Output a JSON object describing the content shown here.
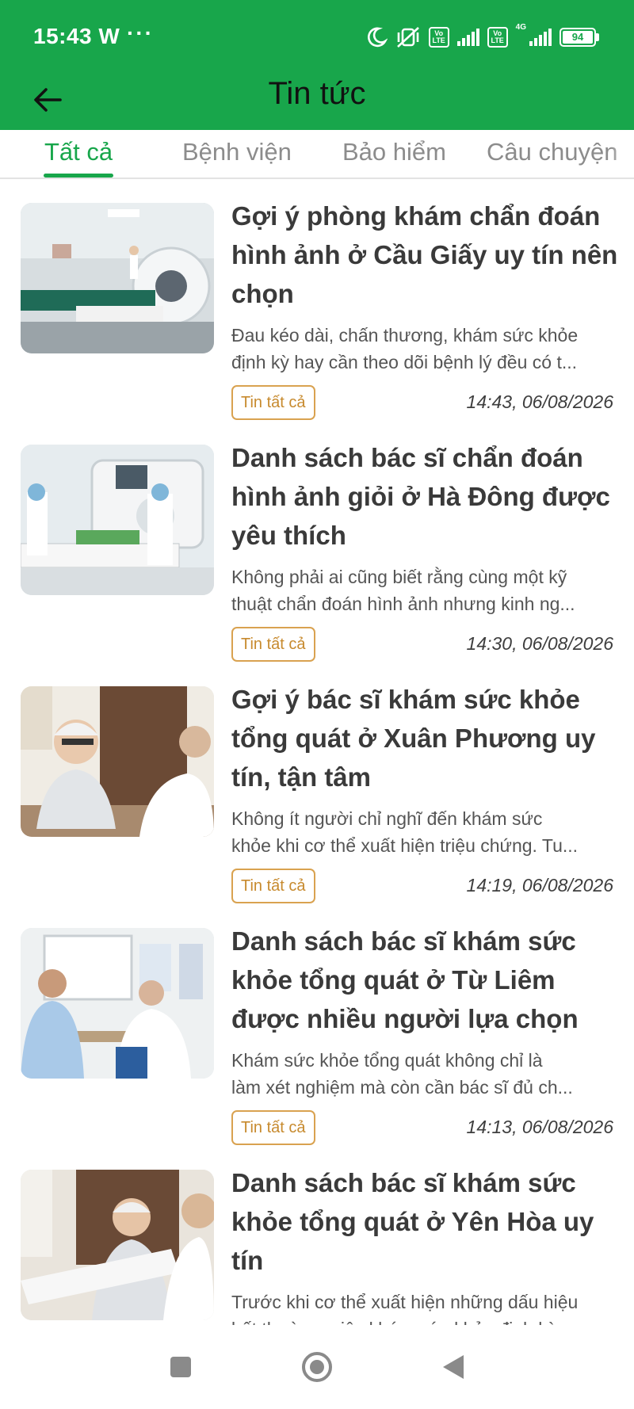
{
  "status_bar": {
    "time": "15:43",
    "time_suffix": "W",
    "more": "···",
    "network": "4G",
    "volte": "Vo LTE",
    "battery": "94"
  },
  "app_bar": {
    "title": "Tin tức",
    "back_icon": "arrow-left-icon"
  },
  "tabs": [
    {
      "label": "Tất cả",
      "active": true
    },
    {
      "label": "Bệnh viện",
      "active": false
    },
    {
      "label": "Bảo hiểm",
      "active": false
    },
    {
      "label": "Câu chuyện",
      "active": false
    }
  ],
  "articles": [
    {
      "title": "Gợi ý phòng khám chẩn đoán hình ảnh ở Cầu Giấy uy tín nên chọn",
      "desc_line1": "Đau kéo dài, chấn thương, khám sức khỏe",
      "desc_line2": "định kỳ hay cần theo dõi bệnh lý đều có t...",
      "tag": "Tin tất cả",
      "time": "14:43, 06/08/2026"
    },
    {
      "title": "Danh sách bác sĩ chẩn đoán hình ảnh giỏi ở Hà Đông được yêu thích",
      "desc_line1": "Không phải ai cũng biết rằng cùng một kỹ",
      "desc_line2": "thuật chẩn đoán hình ảnh nhưng kinh ng...",
      "tag": "Tin tất cả",
      "time": "14:30, 06/08/2026"
    },
    {
      "title": "Gợi ý bác sĩ khám sức khỏe tổng quát ở Xuân Phương uy tín, tận tâm",
      "desc_line1": "Không ít người chỉ nghĩ đến khám sức",
      "desc_line2": "khỏe khi cơ thể xuất hiện triệu chứng. Tu...",
      "tag": "Tin tất cả",
      "time": "14:19, 06/08/2026"
    },
    {
      "title": "Danh sách bác sĩ khám sức khỏe tổng quát ở Từ Liêm được nhiều người lựa chọn",
      "desc_line1": "Khám sức khỏe tổng quát không chỉ là",
      "desc_line2": "làm xét nghiệm mà còn cần bác sĩ đủ ch...",
      "tag": "Tin tất cả",
      "time": "14:13, 06/08/2026"
    },
    {
      "title": "Danh sách bác sĩ khám sức khỏe tổng quát ở Yên Hòa uy tín",
      "desc_line1": "Trước khi cơ thể xuất hiện những dấu hiệu",
      "desc_line2": "bất thường, việc khám sức khỏe định kỳ",
      "tag": "",
      "time": ""
    }
  ],
  "nav_bar": {
    "recents_icon": "square-icon",
    "home_icon": "circle-icon",
    "back_icon": "triangle-back-icon"
  },
  "colors": {
    "brand_green": "#18a64b",
    "tag_orange": "#d9a250",
    "title_text": "#3a3a3a"
  }
}
